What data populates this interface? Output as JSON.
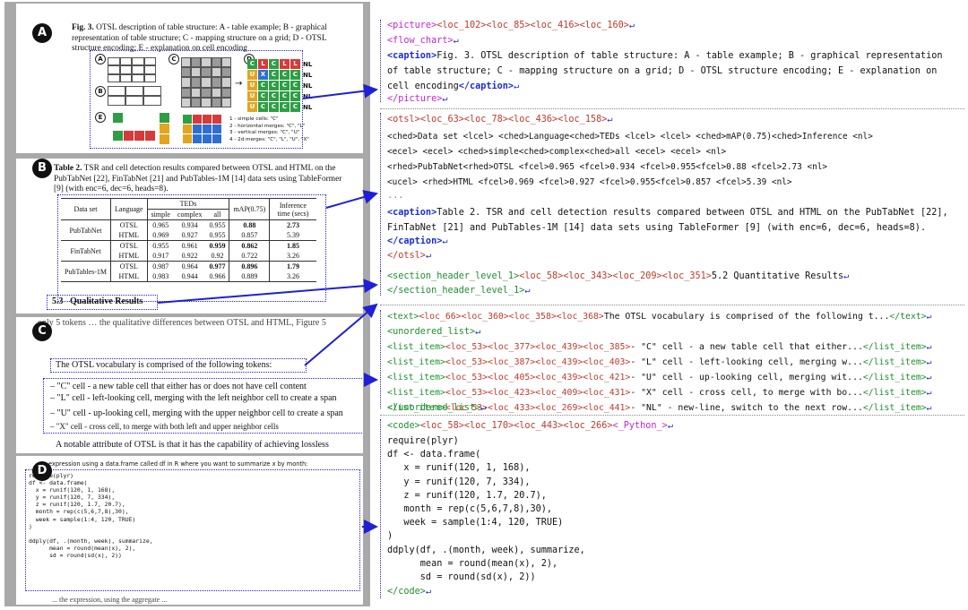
{
  "badges": [
    "A",
    "B",
    "C",
    "D"
  ],
  "snippet_a": {
    "caption_bold": "Fig. 3.",
    "caption": "OTSL description of table structure: A - table example; B - graphical representation of table structure; C - mapping structure on a grid; D - OTSL structure encoding; E - explanation on cell encoding",
    "fig_letters": [
      "A",
      "B",
      "C",
      "D",
      "E"
    ],
    "otsl_rows": [
      [
        "C",
        "L",
        "C",
        "L",
        "L"
      ],
      [
        "U",
        "X",
        "C",
        "C",
        "C"
      ],
      [
        "U",
        "C",
        "C",
        "C",
        "C"
      ],
      [
        "U",
        "C",
        "C",
        "C",
        "C"
      ],
      [
        "U",
        "C",
        "C",
        "C",
        "C"
      ]
    ],
    "nl_label": "NL",
    "e_legend": [
      "1 - simple cells: \"C\"",
      "2 - horizontal merges: \"C\", \"L\"",
      "3 - vertical merges: \"C\", \"U\"",
      "4 - 2d merges: \"C\", \"L\", \"U\", \"X\""
    ]
  },
  "snippet_b": {
    "caption_bold": "Table 2.",
    "caption": "TSR and cell detection results compared between OTSL and HTML on the PubTabNet [22], FinTabNet [21] and PubTables-1M [14] data sets using TableFormer [9] (with enc=6, dec=6, heads=8).",
    "headers": {
      "dataset": "Data set",
      "language": "Language",
      "teds": "TEDs",
      "simple": "simple",
      "complex": "complex",
      "all": "all",
      "map": "mAP(0.75)",
      "inference": "Inference time (secs)"
    },
    "rows": [
      {
        "dataset": "PubTabNet",
        "lang": "OTSL",
        "simple": "0.965",
        "complex": "0.934",
        "all": "0.955",
        "map": "0.88",
        "time": "2.73"
      },
      {
        "dataset": "",
        "lang": "HTML",
        "simple": "0.969",
        "complex": "0.927",
        "all": "0.955",
        "map": "0.857",
        "time": "5.39"
      },
      {
        "dataset": "FinTabNet",
        "lang": "OTSL",
        "simple": "0.955",
        "complex": "0.961",
        "all": "0.959",
        "map": "0.862",
        "time": "1.85"
      },
      {
        "dataset": "",
        "lang": "HTML",
        "simple": "0.917",
        "complex": "0.922",
        "all": "0.92",
        "map": "0.722",
        "time": "3.26"
      },
      {
        "dataset": "PubTables-1M",
        "lang": "OTSL",
        "simple": "0.987",
        "complex": "0.964",
        "all": "0.977",
        "map": "0.896",
        "time": "1.79"
      },
      {
        "dataset": "",
        "lang": "HTML",
        "simple": "0.983",
        "complex": "0.944",
        "all": "0.966",
        "map": "0.889",
        "time": "3.26"
      }
    ],
    "section_header": "5.3   Qualitative Results"
  },
  "snippet_c": {
    "top_fragment": "only 5 tokens … the qualitative differences between OTSL and HTML, Figure 5",
    "intro": "The OTSL vocabulary is comprised of the following tokens:",
    "items": [
      "– \"C\" cell - a new table cell that either has or does not have cell content",
      "– \"L\" cell - left-looking cell, merging with the left neighbor cell to create a span",
      "– \"U\" cell - up-looking cell, merging with the upper neighbor cell to create a span",
      "– \"X\" cell - cross cell, to merge with both left and upper neighbor cells",
      "– \"NL\" - new-line, switch to the next row."
    ],
    "trailing": "A notable attribute of OTSL is that it has the capability of achieving lossless"
  },
  "snippet_d": {
    "intro": "expression using a data.frame called df in R where you want to summarize x by month:",
    "code": "require(plyr)\ndf <- data.frame(\n  x = runif(120, 1, 168),\n  y = runif(120, 7, 334),\n  z = runif(120, 1.7, 20.7),\n  month = rep(c(5,6,7,8),30),\n  week = sample(1:4, 120, TRUE)\n)\n\nddply(df, .(month, week), summarize,\n      mean = round(mean(x), 2),\n      sd = round(sd(x), 2))",
    "bottom_fragment": "... the expression, using the aggregate ..."
  },
  "right": {
    "picture": {
      "open_tag": "<picture>",
      "locs": "<loc_102><loc_85><loc_416><loc_160>",
      "flow": "<flow_chart>",
      "caption_open": "<caption>",
      "caption_line1": "Fig. 3. OTSL description of table structure: A - table example; B - graphical representation",
      "caption_line2": "of table structure; C - mapping structure on a grid; D - OTSL structure encoding; E - explanation on",
      "caption_line3": "cell encoding",
      "caption_close": "</caption>",
      "close_tag": "</picture>"
    },
    "otsl": {
      "open_tag": "<otsl>",
      "locs": "<loc_63><loc_78><loc_436><loc_158>",
      "l1": "<ched>Data set <lcel> <ched>Language<ched>TEDs <lcel> <lcel> <ched>mAP(0.75)<ched>Inference <nl>",
      "l2": "<ecel> <ecel> <ched>simple<ched>complex<ched>all <ecel> <ecel> <nl>",
      "l3": "<rhed>PubTabNet<rhed>OTSL <fcel>0.965 <fcel>0.934 <fcel>0.955<fcel>0.88 <fcel>2.73 <nl>",
      "l4": "<ucel> <rhed>HTML <fcel>0.969 <fcel>0.927 <fcel>0.955<fcel>0.857 <fcel>5.39 <nl>",
      "ellipsis": "...",
      "caption_open": "<caption>",
      "caption_line1": "Table 2. TSR and cell detection results compared between OTSL and HTML on the PubTabNet [22],",
      "caption_line2": "FinTabNet [21] and PubTables-1M [14] data sets using TableFormer [9] (with enc=6, dec=6, heads=8).",
      "caption_close": "</caption>",
      "close_tag": "</otsl>"
    },
    "section": {
      "open_tag": "<section_header_level_1>",
      "locs": "<loc_58><loc_343><loc_209><loc_351>",
      "text": "5.2 Quantitative Results",
      "close_tag": "</section_header_level_1>"
    },
    "text_block": {
      "open_tag": "<text>",
      "locs": "<loc_66><loc_360><loc_358><loc_368>",
      "text": "The OTSL vocabulary is comprised of the following t...",
      "close_tag": "</text>",
      "list_open": "<unordered_list>",
      "items": [
        {
          "locs": "<loc_53><loc_377><loc_439><loc_385>",
          "text": "- \"C\" cell - a new table cell that either..."
        },
        {
          "locs": "<loc_53><loc_387><loc_439><loc_403>",
          "text": "- \"L\" cell - left-looking cell, merging w..."
        },
        {
          "locs": "<loc_53><loc_405><loc_439><loc_421>",
          "text": "- \"U\" cell - up-looking cell, merging wit..."
        },
        {
          "locs": "<loc_53><loc_423><loc_409><loc_431>",
          "text": "- \"X\" cell - cross cell, to merge with bo..."
        },
        {
          "locs": "<loc_53><loc_433><loc_269><loc_441>",
          "text": "- \"NL\" - new-line, switch to the next row..."
        }
      ],
      "item_open": "<list_item>",
      "item_close": "</list_item>",
      "list_close": "</unordered_list>"
    },
    "code_block": {
      "open_tag": "<code>",
      "locs": "<loc_58><loc_170><loc_443><loc_266>",
      "lang": "<_Python_>",
      "lines": [
        "require(plyr)",
        "df <- data.frame(",
        "   x = runif(120, 1, 168),",
        "   y = runif(120, 7, 334),",
        "   z = runif(120, 1.7, 20.7),",
        "   month = rep(c(5,6,7,8),30),",
        "   week = sample(1:4, 120, TRUE)",
        ")",
        "ddply(df, .(month, week), summarize,",
        "      mean = round(mean(x), 2),",
        "      sd = round(sd(x), 2))"
      ],
      "close_tag": "</code>"
    },
    "return_glyph": "↵"
  },
  "colors": {
    "tag_red": "#c0392b",
    "tag_blue": "#1a2bd6",
    "tag_magenta": "#c026d3",
    "tag_green": "#1e8f2f",
    "arrow": "#1f1fd6"
  }
}
